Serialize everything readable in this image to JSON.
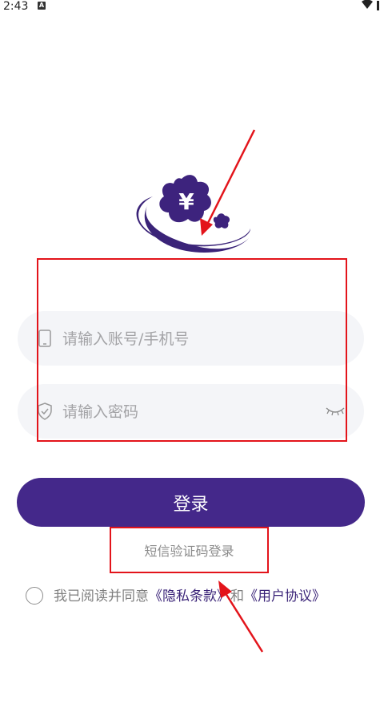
{
  "status_bar": {
    "time": "2:43",
    "notification_icon": "a-icon"
  },
  "logo": {
    "glyph": "¥"
  },
  "account_field": {
    "placeholder": "请输入账号/手机号",
    "value": ""
  },
  "password_field": {
    "placeholder": "请输入密码",
    "value": ""
  },
  "login_button": {
    "label": "登录"
  },
  "sms_login": {
    "label": "短信验证码登录"
  },
  "agreement": {
    "prefix": "我已阅读并同意",
    "privacy_link": "《隐私条款》",
    "conjunction": "和",
    "user_link": "《用户协议》"
  },
  "colors": {
    "brand": "#44288a",
    "field_bg": "#f4f5f8",
    "annotation": "#e3141b"
  }
}
